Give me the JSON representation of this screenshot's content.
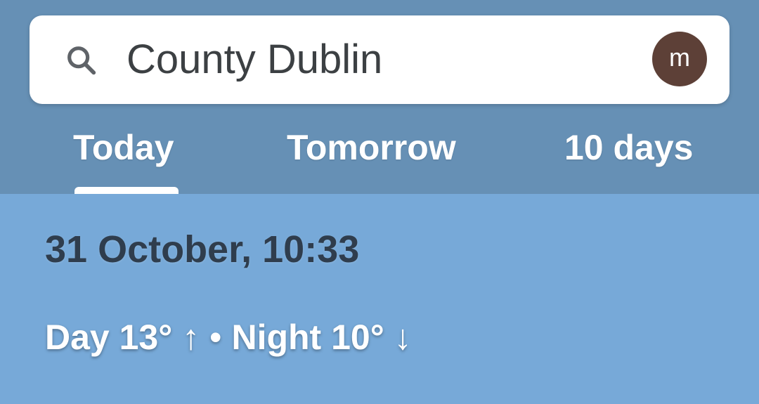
{
  "search": {
    "query": "County Dublin",
    "avatar_letter": "m",
    "icon": "search-icon"
  },
  "tabs": [
    {
      "label": "Today",
      "selected": true
    },
    {
      "label": "Tomorrow",
      "selected": false
    },
    {
      "label": "10 days",
      "selected": false
    }
  ],
  "forecast": {
    "datetime": "31 October, 10:33",
    "day_label": "Day 13°",
    "day_arrow": "↑",
    "separator": "•",
    "night_label": "Night 10°",
    "night_arrow": "↓"
  },
  "colors": {
    "header_bg": "#6690b5",
    "content_bg": "#77a9d8",
    "avatar_bg": "#5d4037"
  }
}
